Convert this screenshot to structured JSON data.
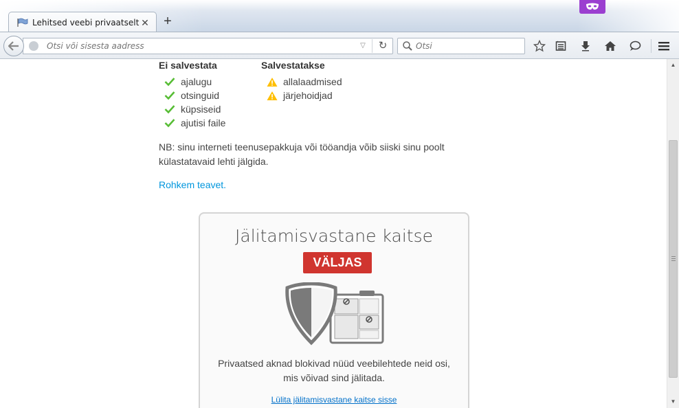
{
  "tab": {
    "title": "Lehitsed veebi privaatselt"
  },
  "navbar": {
    "url_placeholder": "Otsi või sisesta aadress",
    "search_placeholder": "Otsi"
  },
  "not_saved": {
    "heading": "Ei salvestata",
    "items": [
      "ajalugu",
      "otsinguid",
      "küpsiseid",
      "ajutisi faile"
    ]
  },
  "saved": {
    "heading": "Salvestatakse",
    "items": [
      "allalaadmised",
      "järjehoidjad"
    ]
  },
  "note": "NB: sinu interneti teenusepakkuja või tööandja võib siiski sinu poolt külastatavaid lehti jälgida.",
  "more_link": "Rohkem teavet.",
  "tracking": {
    "title": "Jälitamisvastane kaitse",
    "status": "VÄLJAS",
    "description_line1": "Privaatsed aknad blokivad nüüd veebilehtede neid osi,",
    "description_line2": "mis võivad sind jälitada.",
    "toggle_link": "Lülita jälitamisvastane kaitse sisse"
  },
  "colors": {
    "accent_private": "#9b3fd0",
    "status_off": "#d0352f",
    "link": "#0096dd",
    "check": "#57bd35",
    "warning": "#ffbf00"
  }
}
